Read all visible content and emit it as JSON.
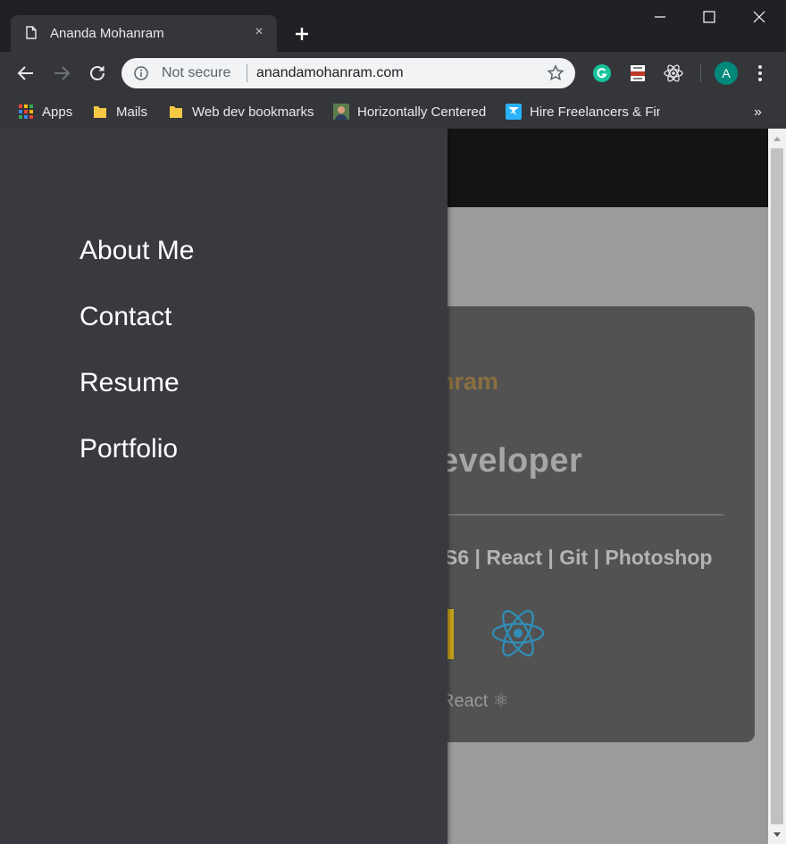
{
  "browser": {
    "tab_title": "Ananda Mohanram",
    "tab_close": "×",
    "security_label": "Not secure",
    "url": "anandamohanram.com",
    "profile_initial": "A",
    "more_bookmarks": "»",
    "bookmarks": [
      {
        "label": "Apps",
        "icon": "apps-grid-icon"
      },
      {
        "label": "Mails",
        "icon": "folder-icon"
      },
      {
        "label": "Web dev bookmarks",
        "icon": "folder-icon"
      },
      {
        "label": "Horizontally Centered",
        "icon": "avatar-favicon"
      },
      {
        "label": "Hire Freelancers & Find",
        "icon": "freelancer-favicon"
      }
    ],
    "extensions": [
      "grammarly-icon",
      "reader-extension-icon",
      "react-devtools-icon"
    ]
  },
  "drawer": {
    "items": [
      "About Me",
      "Contact",
      "Resume",
      "Portfolio"
    ]
  },
  "card": {
    "name_fragment": "nram",
    "role_fragment": "eveloper",
    "skills_fragment": "S6 | React | Git | Photoshop",
    "caption_fragment": "React ⚛"
  },
  "colors": {
    "drawer_bg": "#393a40",
    "page_bg": "#9b9b9b",
    "card_bg": "#525252",
    "name_accent": "#8a6f3f",
    "react_blue": "#2f8fb8"
  }
}
